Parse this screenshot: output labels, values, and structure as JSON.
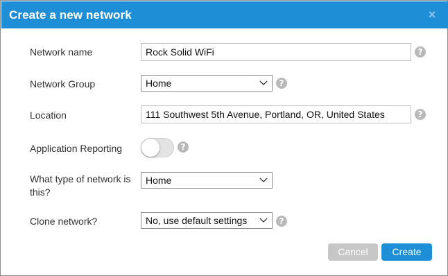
{
  "dialog": {
    "title": "Create a new network",
    "close_glyph": "×"
  },
  "form": {
    "network_name": {
      "label": "Network name",
      "value": "Rock Solid WiFi"
    },
    "network_group": {
      "label": "Network Group",
      "value": "Home"
    },
    "location": {
      "label": "Location",
      "value": "111 Southwest 5th Avenue, Portland, OR, United States"
    },
    "application_reporting": {
      "label": "Application Reporting",
      "enabled": false
    },
    "network_type": {
      "label_line1": "What type of network is",
      "label_line2": "this?",
      "value": "Home"
    },
    "clone_network": {
      "label": "Clone network?",
      "value": "No, use default settings"
    }
  },
  "help_glyph": "?",
  "buttons": {
    "cancel_label": "Cancel",
    "create_label": "Create"
  },
  "colors": {
    "accent": "#1e8fd6",
    "disabled_button": "#c7c7c7",
    "help_icon": "#b9b9b9"
  }
}
